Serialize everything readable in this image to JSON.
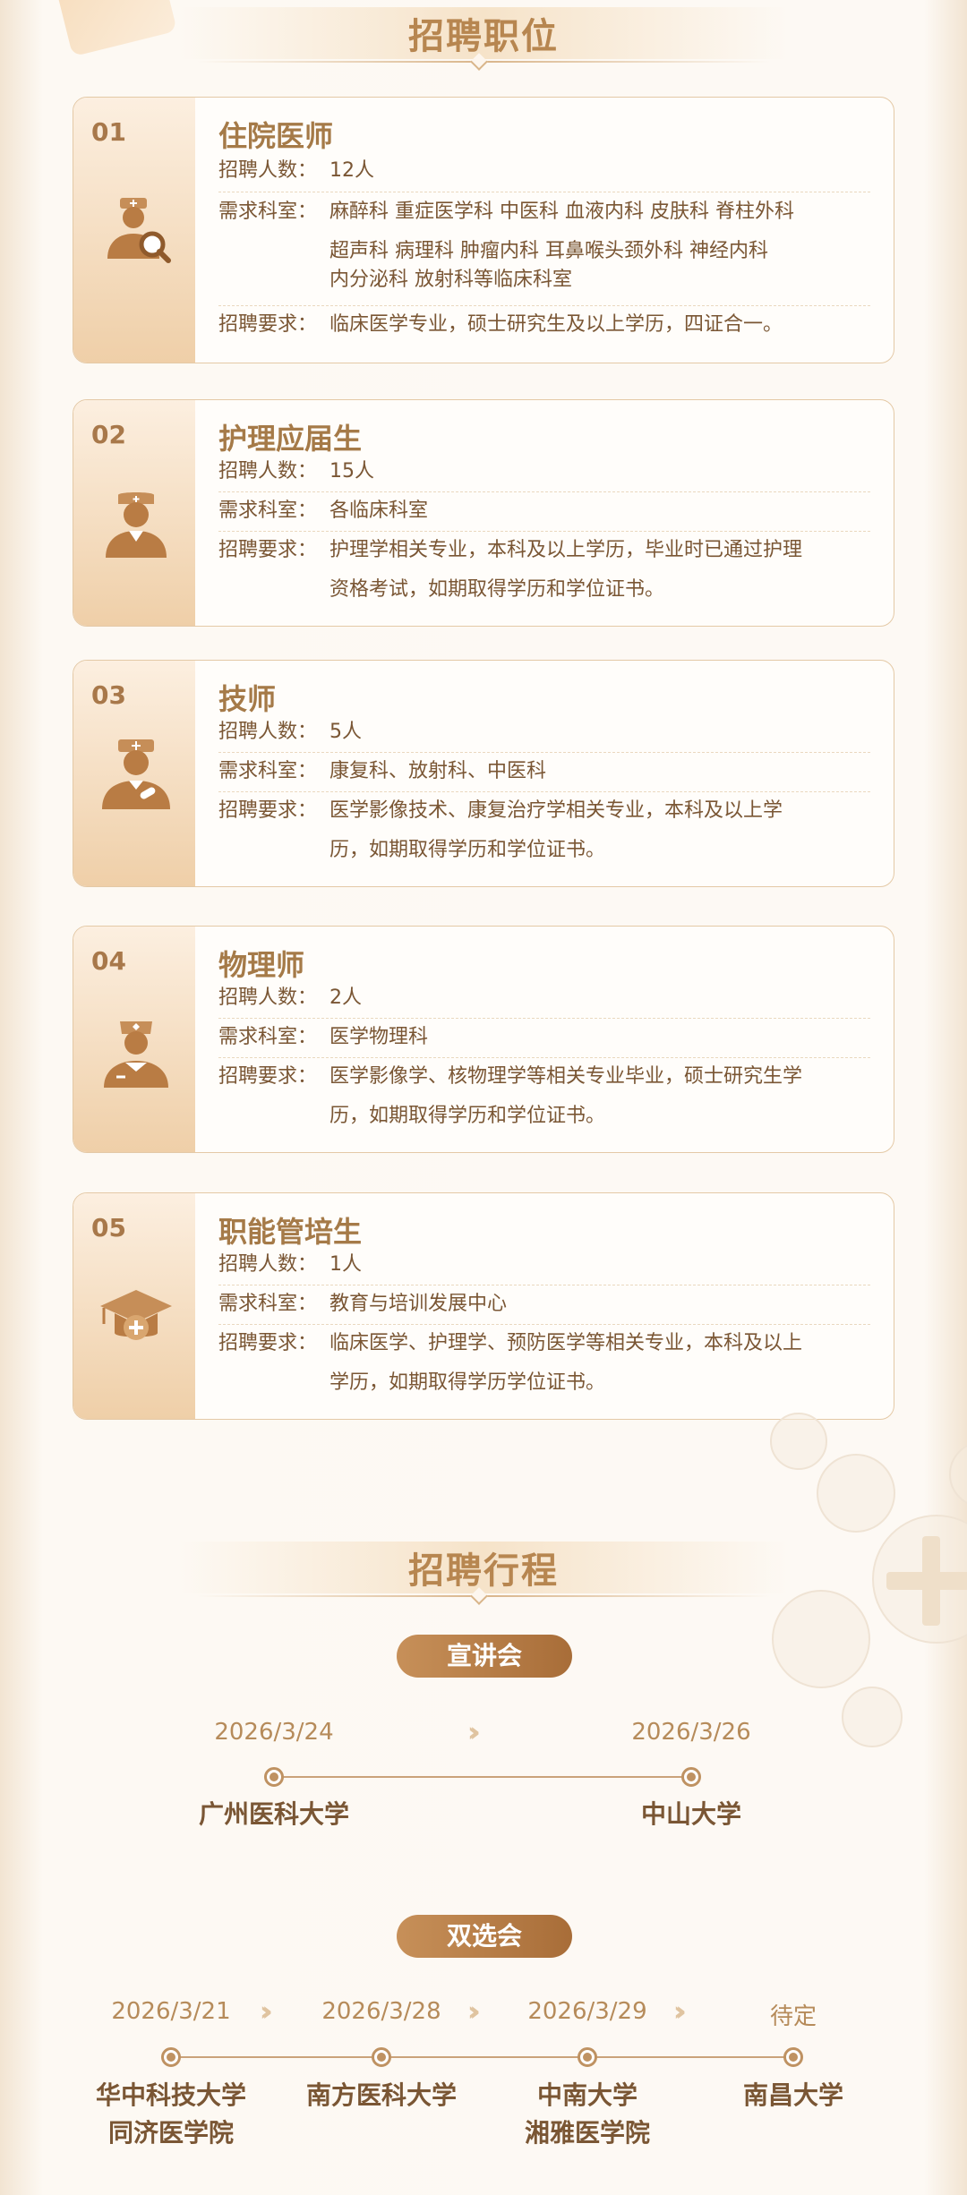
{
  "sections": {
    "positions_title": "招聘职位",
    "schedule_title": "招聘行程"
  },
  "labels": {
    "count": "招聘人数：",
    "dept": "需求科室：",
    "req": "招聘要求："
  },
  "positions": [
    {
      "num": "01",
      "title": "住院医师",
      "icon": "doctor-search-icon",
      "count": "12人",
      "dept_lines": [
        "麻醉科 重症医学科 中医科 血液内科 皮肤科 脊柱外科",
        "超声科  病理科 肿瘤内科 耳鼻喉头颈外科 神经内科",
        "内分泌科 放射科等临床科室"
      ],
      "req_lines": [
        "临床医学专业，硕士研究生及以上学历，四证合一。"
      ]
    },
    {
      "num": "02",
      "title": "护理应届生",
      "icon": "nurse-icon",
      "count": "15人",
      "dept_lines": [
        "各临床科室"
      ],
      "req_lines": [
        "护理学相关专业，本科及以上学历，毕业时已通过护理",
        "资格考试，如期取得学历和学位证书。"
      ]
    },
    {
      "num": "03",
      "title": "技师",
      "icon": "technician-icon",
      "count": "5人",
      "dept_lines": [
        "康复科、放射科、中医科"
      ],
      "req_lines": [
        "医学影像技术、康复治疗学相关专业，本科及以上学",
        "历，如期取得学历和学位证书。"
      ]
    },
    {
      "num": "04",
      "title": "物理师",
      "icon": "physicist-icon",
      "count": "2人",
      "dept_lines": [
        "医学物理科"
      ],
      "req_lines": [
        "医学影像学、核物理学等相关专业毕业，硕士研究生学",
        "历，如期取得学历和学位证书。"
      ]
    },
    {
      "num": "05",
      "title": "职能管培生",
      "icon": "graduation-cap-plus-icon",
      "count": "1人",
      "dept_lines": [
        "教育与培训发展中心"
      ],
      "req_lines": [
        "临床医学、护理学、预防医学等相关专业，本科及以上",
        "学历，如期取得学历学位证书。"
      ]
    }
  ],
  "seminars": {
    "label": "宣讲会",
    "items": [
      {
        "date": "2026/3/24",
        "place": "广州医科大学"
      },
      {
        "date": "2026/3/26",
        "place": "中山大学"
      }
    ]
  },
  "fairs": {
    "label": "双选会",
    "items": [
      {
        "date": "2026/3/21",
        "place_lines": [
          "华中科技大学",
          "同济医学院"
        ]
      },
      {
        "date": "2026/3/28",
        "place_lines": [
          "南方医科大学"
        ]
      },
      {
        "date": "2026/3/29",
        "place_lines": [
          "中南大学",
          "湘雅医学院"
        ]
      },
      {
        "date": "待定",
        "place_lines": [
          "南昌大学"
        ]
      }
    ]
  },
  "colors": {
    "accent": "#a57a48",
    "pill_from": "#c79059",
    "pill_to": "#a86d38",
    "text": "#7a5634"
  }
}
